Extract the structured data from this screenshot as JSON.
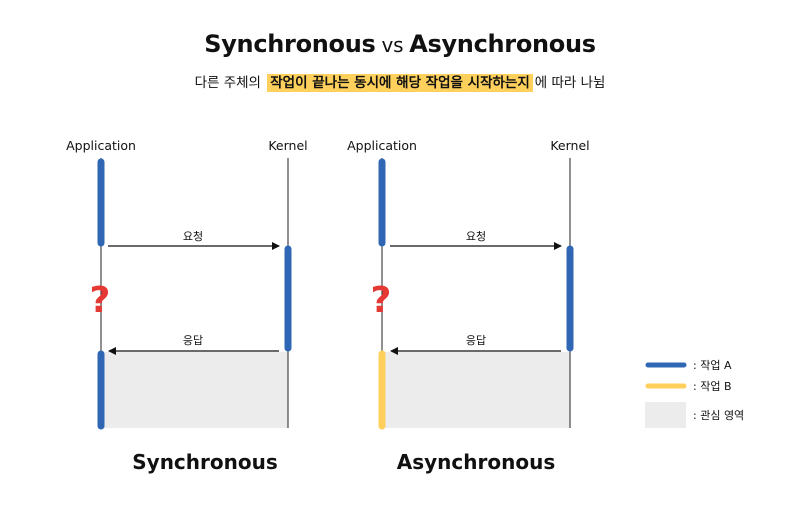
{
  "header": {
    "title_left": "Synchronous",
    "title_vs": "vs",
    "title_right": "Asynchronous",
    "subtitle_before": "다른 주체의",
    "subtitle_highlight": "작업이 끝나는 동시에 해당 작업을 시작하는지",
    "subtitle_after": "에 따라 나뉨"
  },
  "sync": {
    "app_label": "Application",
    "kernel_label": "Kernel",
    "request_label": "요청",
    "response_label": "응답",
    "question_mark": "?",
    "caption": "Synchronous"
  },
  "async": {
    "app_label": "Application",
    "kernel_label": "Kernel",
    "request_label": "요청",
    "response_label": "응답",
    "question_mark": "?",
    "caption": "Asynchronous"
  },
  "legend": {
    "items": [
      {
        "label": ":  작업 A",
        "color": "#2f67b5",
        "kind": "line"
      },
      {
        "label": ":  작업 B",
        "color": "#ffcf5c",
        "kind": "line"
      },
      {
        "label": ":  관심 영역",
        "color": "#ececec",
        "kind": "box"
      }
    ]
  },
  "colors": {
    "task_a": "#2f67b5",
    "task_b": "#ffcf5c",
    "focus_area": "#ececec",
    "question": "#e53935",
    "highlight": "#ffd15c"
  }
}
